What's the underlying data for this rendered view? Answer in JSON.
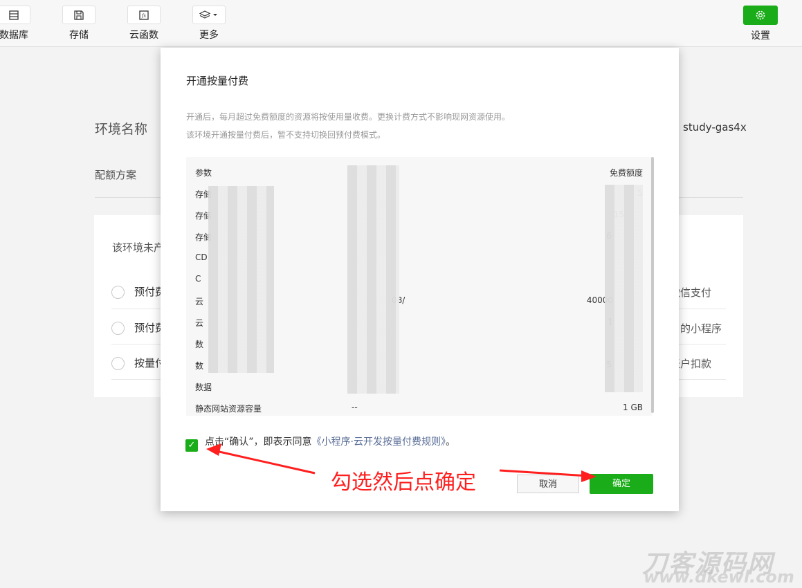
{
  "toolbar": {
    "items": [
      {
        "label": "数据库",
        "icon": "database-icon"
      },
      {
        "label": "存储",
        "icon": "storage-icon"
      },
      {
        "label": "云函数",
        "icon": "function-icon"
      },
      {
        "label": "更多",
        "icon": "layers-icon"
      }
    ],
    "settings_label": "设置",
    "accent": "#1aad19"
  },
  "page": {
    "env_label": "环境名称",
    "env_value": "study-gas4x",
    "quota_label": "配额方案",
    "card_note": "该环境未产",
    "options": [
      {
        "label": "预付费",
        "right": "微信支付"
      },
      {
        "label": "预付费",
        "right": "的小程序"
      },
      {
        "label": "按量付",
        "right": "账户扣款"
      }
    ]
  },
  "modal": {
    "title": "开通按量付费",
    "desc_line1": "开通后，每月超过免费额度的资源将按使用量收费。更换计费方式不影响现网资源使用。",
    "desc_line2": "该环境开通按量付费后，暂不支持切换回预付费模式。",
    "table": {
      "header": {
        "c1": "参数",
        "c2": "",
        "c3": "免费额度"
      },
      "rows": [
        {
          "c1": "存储",
          "c2": "",
          "c3": "5"
        },
        {
          "c1": "存储",
          "c2": "",
          "c3": "15"
        },
        {
          "c1": "存储",
          "c2": "",
          "c3": "6"
        },
        {
          "c1": "CD",
          "c2": "",
          "c3": ""
        },
        {
          "c1": "C",
          "c2": "",
          "c3": ""
        },
        {
          "c1": "云",
          "c2": "08/",
          "c3": "40000"
        },
        {
          "c1": "云",
          "c2": "",
          "c3": "1"
        },
        {
          "c1": "数",
          "c2": "",
          "c3": ""
        },
        {
          "c1": "数",
          "c2": "",
          "c3": "5"
        },
        {
          "c1": "数据",
          "c2": "",
          "c3": ""
        },
        {
          "c1": "静态网站资源容量",
          "c2": "--",
          "c3": "1 GB"
        }
      ]
    },
    "agree_prefix": "点击“确认”，即表示同意",
    "agree_link": "《小程序·云开发按量付费规则》",
    "agree_suffix": "。",
    "cancel_label": "取消",
    "ok_label": "确定"
  },
  "annotation": {
    "text": "勾选然后点确定",
    "color": "#ff1f1f"
  },
  "watermark": {
    "line1": "刀客源码网",
    "line2": "www.dkewl.com"
  }
}
